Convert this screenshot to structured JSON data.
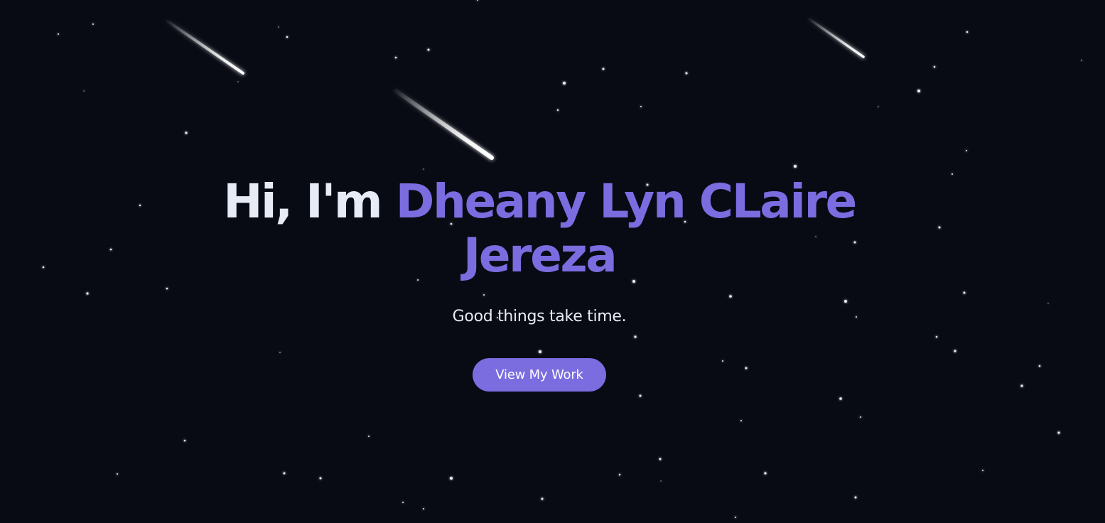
{
  "hero": {
    "greeting": "Hi, I'm",
    "name": "Dheany Lyn CLaire Jereza",
    "tagline": "Good things take time.",
    "cta_label": "View My Work"
  },
  "theme": {
    "background": "#080b14",
    "text": "#e6ebf5",
    "accent": "#7b6ce0",
    "button_text": "#ffffff",
    "star": "#ffffff"
  },
  "decorations": {
    "star_icon": "star-dot",
    "meteor_icon": "shooting-star"
  }
}
